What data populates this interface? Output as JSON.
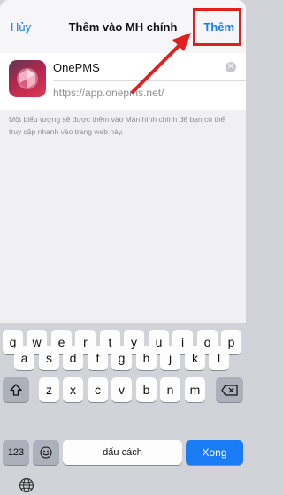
{
  "header": {
    "cancel_label": "Hủy",
    "title": "Thêm vào MH chính",
    "add_label": "Thêm"
  },
  "app": {
    "name": "OnePMS",
    "url": "https://app.onepms.net/"
  },
  "description": "Một biểu tượng sẽ được thêm vào Màn hình chính để bạn có thể truy cập nhanh vào trang web này.",
  "keyboard": {
    "row1": [
      "q",
      "w",
      "e",
      "r",
      "t",
      "y",
      "u",
      "i",
      "o",
      "p"
    ],
    "row2": [
      "a",
      "s",
      "d",
      "f",
      "g",
      "h",
      "j",
      "k",
      "l"
    ],
    "row3": [
      "z",
      "x",
      "c",
      "v",
      "b",
      "n",
      "m"
    ],
    "numbers_label": "123",
    "space_label": "dấu cách",
    "go_label": "Xong",
    "return_label": "Xong"
  },
  "colors": {
    "accent": "#1a7cf5",
    "highlight": "#e21f1f"
  }
}
